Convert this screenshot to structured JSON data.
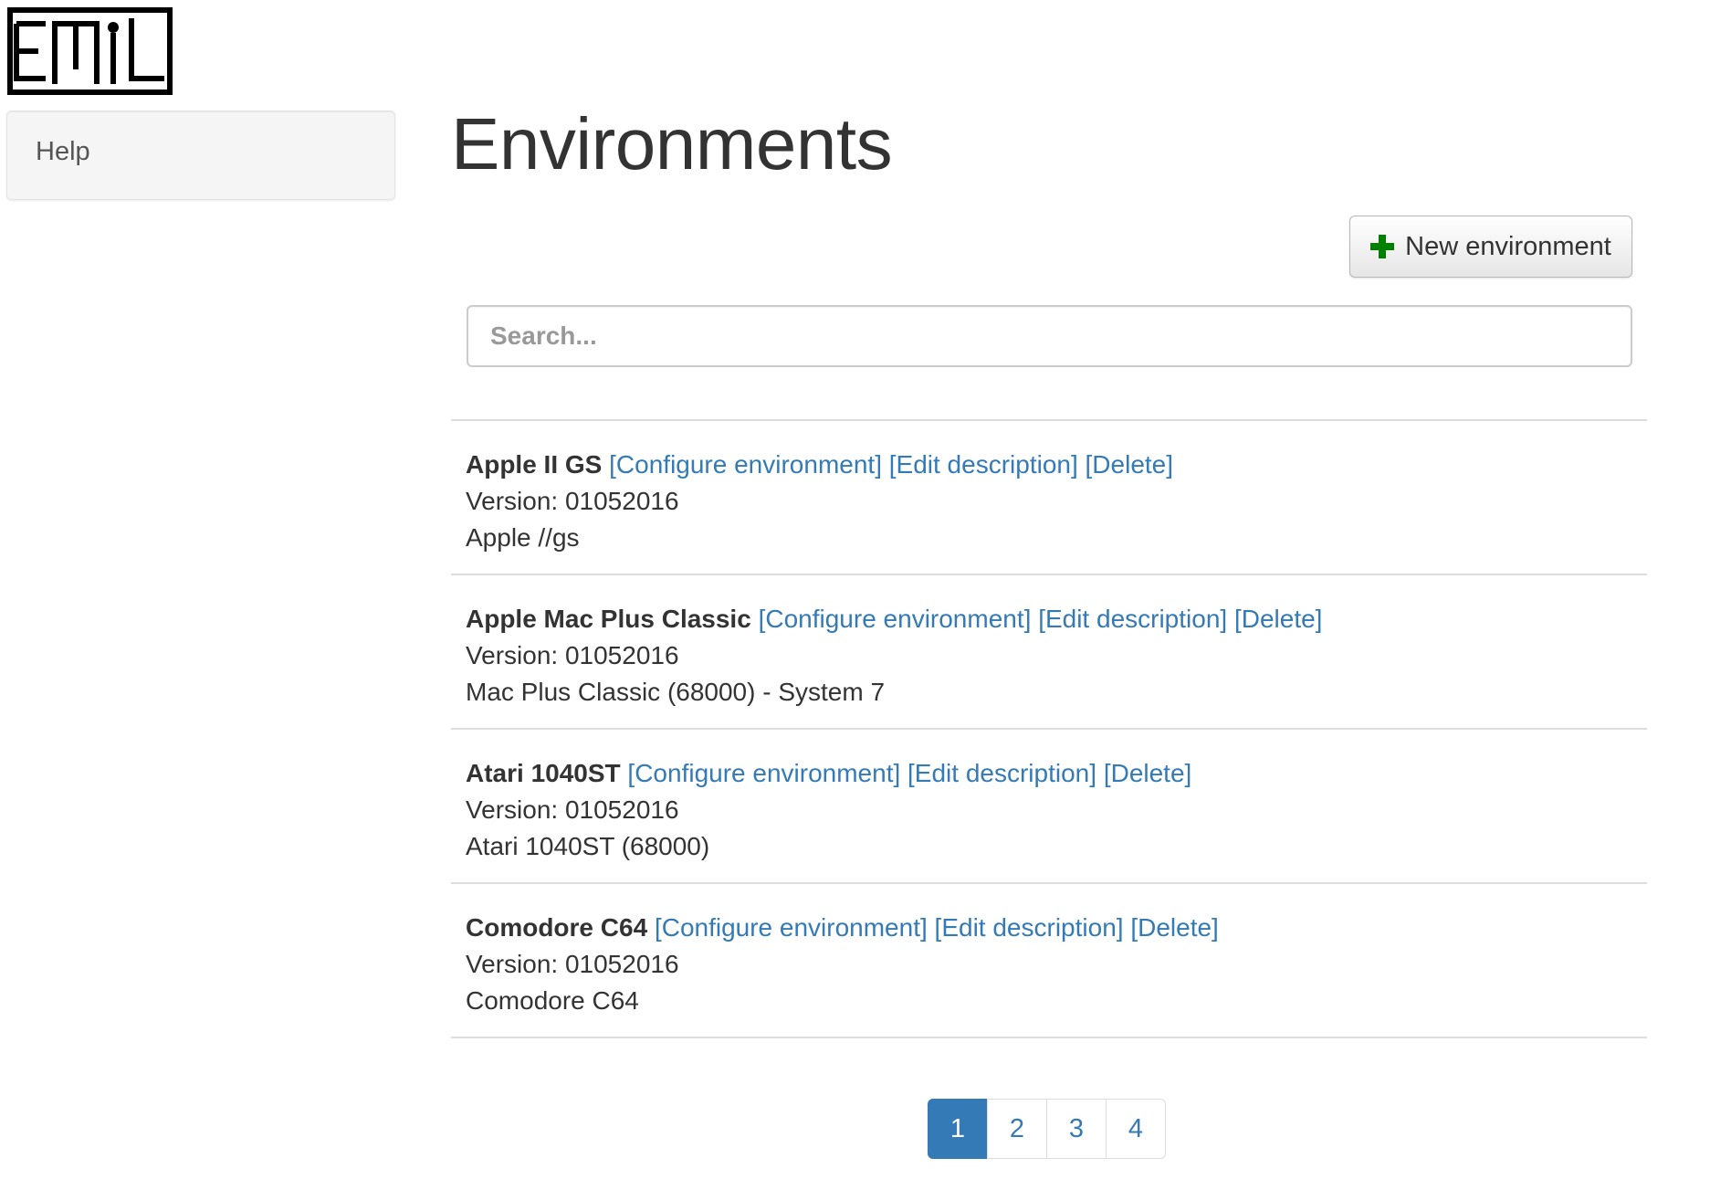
{
  "logo": {
    "text": "EMiL"
  },
  "sidebar": {
    "items": [
      {
        "label": "Help"
      }
    ]
  },
  "main": {
    "title": "Environments",
    "new_button": {
      "label": "New environment",
      "icon": "plus-icon",
      "icon_color": "#008000"
    },
    "search": {
      "placeholder": "Search...",
      "value": ""
    },
    "environments": [
      {
        "name": "Apple II GS",
        "actions": {
          "configure": "[Configure environment]",
          "edit": "[Edit description]",
          "delete": "[Delete]"
        },
        "version": "Version: 01052016",
        "description": "Apple //gs"
      },
      {
        "name": "Apple Mac Plus Classic",
        "actions": {
          "configure": "[Configure environment]",
          "edit": "[Edit description]",
          "delete": "[Delete]"
        },
        "version": "Version: 01052016",
        "description": "Mac Plus Classic (68000) - System 7"
      },
      {
        "name": "Atari 1040ST",
        "actions": {
          "configure": "[Configure environment]",
          "edit": "[Edit description]",
          "delete": "[Delete]"
        },
        "version": "Version: 01052016",
        "description": "Atari 1040ST (68000)"
      },
      {
        "name": "Comodore C64",
        "actions": {
          "configure": "[Configure environment]",
          "edit": "[Edit description]",
          "delete": "[Delete]"
        },
        "version": "Version: 01052016",
        "description": "Comodore C64"
      }
    ],
    "pagination": {
      "pages": [
        "1",
        "2",
        "3",
        "4"
      ],
      "active": "1"
    }
  },
  "colors": {
    "link": "#337ab7",
    "active_page": "#337ab7",
    "plus_icon": "#008000"
  }
}
